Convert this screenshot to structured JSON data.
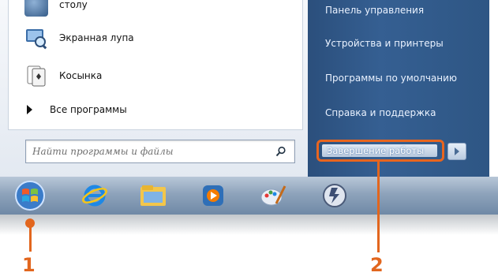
{
  "start_menu": {
    "left_items": [
      {
        "label": "столу",
        "icon": "desktop-icon"
      },
      {
        "label": "Экранная лупа",
        "icon": "magnifier-icon"
      },
      {
        "label": "Косынка",
        "icon": "solitaire-icon"
      }
    ],
    "all_programs_label": "Все программы",
    "search": {
      "placeholder": "Найти программы и файлы"
    },
    "right_items": [
      {
        "label": "Панель управления"
      },
      {
        "label": "Устройства и принтеры"
      },
      {
        "label": "Программы по умолчанию"
      },
      {
        "label": "Справка и поддержка"
      }
    ],
    "shutdown_label": "Завершение работы"
  },
  "taskbar": {
    "items": [
      {
        "icon": "windows-start-orb-icon"
      },
      {
        "icon": "internet-explorer-icon"
      },
      {
        "icon": "file-explorer-icon"
      },
      {
        "icon": "media-player-icon"
      },
      {
        "icon": "paint-icon"
      },
      {
        "icon": "application-icon"
      }
    ]
  },
  "callouts": [
    {
      "number": "1"
    },
    {
      "number": "2"
    }
  ],
  "colors": {
    "callout": "#e2661e",
    "right_pane": "#2f5888"
  }
}
